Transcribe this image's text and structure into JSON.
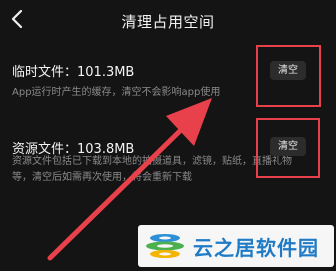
{
  "header": {
    "title": "清理占用空间",
    "back_icon": "chevron-left-icon"
  },
  "items": [
    {
      "title": "临时文件：101.3MB",
      "description": "App运行时产生的缓存，清空不会影响app使用",
      "button_label": "清空"
    },
    {
      "title": "资源文件：103.8MB",
      "description_lines": [
        "资源文件包括已下载到本地的拍摄道具，滤镜，贴纸，直播礼物",
        "等，清空后如需再次使用，将会重新下载"
      ],
      "button_label": "清空"
    }
  ],
  "annotation": {
    "color": "#e8414b"
  },
  "watermark": {
    "text": "云之居软件园"
  },
  "colors": {
    "background": "#141414",
    "button_bg": "#2c2c2c",
    "secondary_text": "#8a8a8a",
    "watermark_text": "#1f7bc6"
  }
}
